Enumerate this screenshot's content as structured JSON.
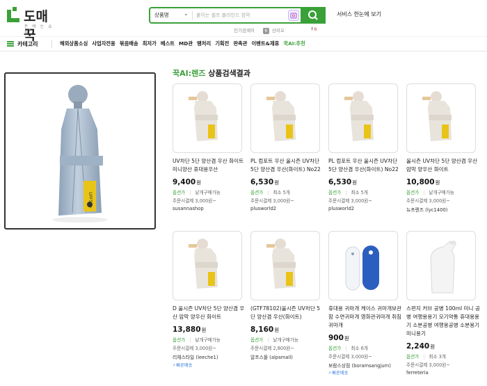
{
  "logo": {
    "name": "도매꾹",
    "sub": "돈 버 는 쇼 핑"
  },
  "search": {
    "category": "상품명",
    "placeholder": "붙이는 셀프 블라인드 암막"
  },
  "service_link": "서비스 한눈에 보기",
  "popular": {
    "label": "인기검색어",
    "rank": "6",
    "term": "산리오",
    "page": "6"
  },
  "nav": {
    "category_label": "카테고리",
    "items": [
      "해외상품소싱",
      "사업자전용",
      "묶음배송",
      "최저가",
      "베스트",
      "MD관",
      "땡처리",
      "기획전",
      "판촉관",
      "이벤트&제휴",
      "꾹AI:추천"
    ]
  },
  "results": {
    "title_green": "꾹AI:렌즈",
    "title_rest": " 상품검색결과"
  },
  "products": [
    {
      "title": "UV차단 5단 양산겸 우산 화이트 미니양산 휴대용우산",
      "price": "9,400",
      "unit": "원",
      "opt": "옵션가",
      "opt2": "낱개구매가능",
      "ship": "주문시결제 3,000원~",
      "seller": "susannashop",
      "fast": ""
    },
    {
      "title": "PL 컴포트 우산 울시즌 UV차단 5단 양산겸 우산(화이트) No22",
      "price": "6,530",
      "unit": "원",
      "opt": "옵션가",
      "opt2": "최소 5개",
      "ship": "주문시결제 3,000원~",
      "seller": "plusworld2",
      "fast": ""
    },
    {
      "title": "PL 컴포트 우산 울시즌 UV차단 5단 양산겸 우산(화이트) No22",
      "price": "6,530",
      "unit": "원",
      "opt": "옵션가",
      "opt2": "최소 5개",
      "ship": "주문시결제 3,000원~",
      "seller": "plusworld2",
      "fast": ""
    },
    {
      "title": "울시즌 UV차단 5단 양산겸 우산 암막 양우산 화이트",
      "price": "10,800",
      "unit": "원",
      "opt": "옵션가",
      "opt2": "낱개구매가능",
      "ship": "주문시결제 3,000원~",
      "seller": "뉴프렌즈 (lyc1400)",
      "fast": ""
    },
    {
      "title": "D 울시즌 UV차단 5단 양산겸 우산 암막 양우산 화이트",
      "price": "13,880",
      "unit": "원",
      "opt": "옵션가",
      "opt2": "낱개구매가능",
      "ship": "주문시결제 3,000원~",
      "seller": "리체스타일 (leeche1)",
      "fast": "빠른배송"
    },
    {
      "title": "(GTF78102)울시즌 UV차단 5단 양산겸 우산(화이트)",
      "price": "8,160",
      "unit": "원",
      "opt": "옵션가",
      "opt2": "낱개구매가능",
      "ship": "주문시결제 2,800원~",
      "seller": "알프스몰 (alpsmall)",
      "fast": ""
    },
    {
      "title": "휴대용 귀마개 케이스 귀마개보관함 수면귀마개 영화관귀마개 취침귀마개",
      "price": "900",
      "unit": "원",
      "opt": "옵션가",
      "opt2": "최소 6개",
      "ship": "주문시결제 3,000원~",
      "seller": "보람스상점 (boramsangjum)",
      "fast": "빠른배송"
    },
    {
      "title": "스펀지 커브 공병 100ml 미니 공병 여행용용기 모기약통 휴대용용기 소분공병 여행용공병 소분용기 미니용기",
      "price": "2,240",
      "unit": "원",
      "opt": "옵션가",
      "opt2": "최소 3개",
      "ship": "주문시결제 3,000원~",
      "seller": "ferreteria",
      "fast": ""
    }
  ]
}
